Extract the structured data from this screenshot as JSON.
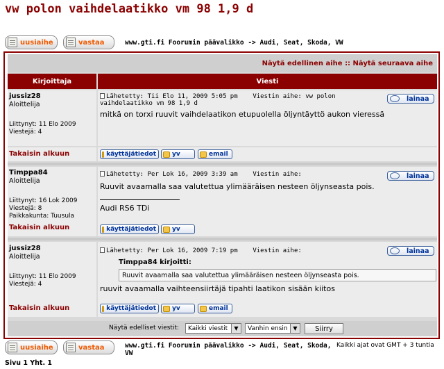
{
  "page": {
    "title": "vw polon vaihdelaatikko vm 98 1,9 d",
    "new_topic_label": "uusiaihe",
    "reply_label": "vastaa",
    "breadcrumb_prefix": "www.gti.fi Foorumin päävalikko",
    "breadcrumb_arrow": "->",
    "breadcrumb_forum": "Audi, Seat, Skoda, VW"
  },
  "nav": {
    "prev": "Näytä edellinen aihe",
    "sep": "::",
    "next": "Näytä seuraava aihe"
  },
  "table_headers": {
    "author": "Kirjoittaja",
    "message": "Viesti"
  },
  "posts": [
    {
      "author": "jussiz28",
      "rank": "Aloittelija",
      "joined": "Liittynyt: 11 Elo 2009",
      "posts_count": "Viestejä: 4",
      "location": "",
      "posted": "Lähetetty: Tii Elo 11, 2009 5:05 pm",
      "subject": "Viestin aihe: vw polon vaihdelaatikko vm 98 1,9 d",
      "body": "mitkä on torxi ruuvit vaihdelaatikon etupuolella öljyntäyttö aukon vieressä",
      "signature": "",
      "quote_author": "",
      "quote_text": ""
    },
    {
      "author": "Timppa84",
      "rank": "Aloittelija",
      "joined": "Liittynyt: 16 Lok 2009",
      "posts_count": "Viestejä: 8",
      "location": "Paikkakunta: Tuusula",
      "posted": "Lähetetty: Per Lok 16, 2009 3:39 am",
      "subject": "Viestin aihe:",
      "body": "Ruuvit avaamalla saa valutettua ylimääräisen nesteen öljynseasta pois.",
      "signature": "Audi RS6 TDi",
      "quote_author": "",
      "quote_text": ""
    },
    {
      "author": "jussiz28",
      "rank": "Aloittelija",
      "joined": "Liittynyt: 11 Elo 2009",
      "posts_count": "Viestejä: 4",
      "location": "",
      "posted": "Lähetetty: Per Lok 16, 2009 7:19 pm",
      "subject": "Viestin aihe:",
      "body": "ruuvit avaamalla vaihteensiirtäjä tipahti laatikon sisään kiitos",
      "signature": "",
      "quote_author": "Timppa84 kirjoitti:",
      "quote_text": "Ruuvit avaamalla saa valutettua ylimääräisen nesteen öljynseasta pois."
    }
  ],
  "buttons": {
    "quote": "lainaa",
    "profile": "käyttäjätiedot",
    "pm": "yv",
    "email": "email",
    "back_to_top": "Takaisin alkuun"
  },
  "footer": {
    "show_prev_label": "Näytä edelliset viestit:",
    "filter_value": "Kaikki viestit",
    "order_value": "Vanhin ensin",
    "go_label": "Siirry",
    "timezone": "Kaikki ajat ovat GMT + 3 tuntia",
    "pagination": "Sivu 1 Yht. 1"
  }
}
